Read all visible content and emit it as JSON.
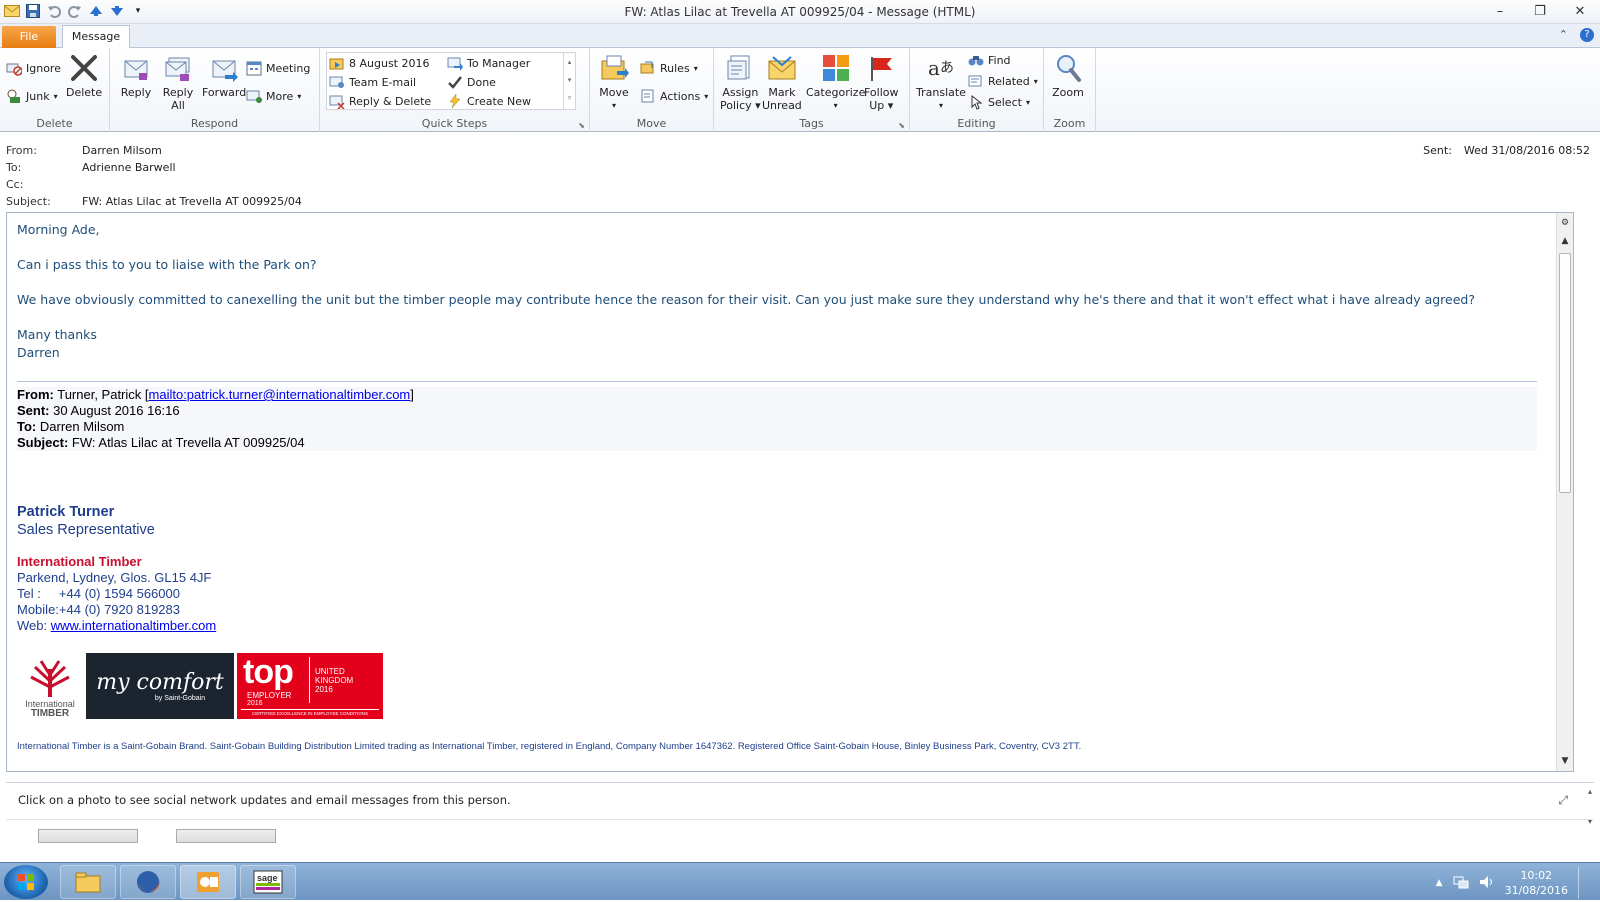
{
  "window": {
    "title": "FW: Atlas Lilac at Trevella AT 009925/04  -  Message (HTML)"
  },
  "tabs": {
    "file": "File",
    "message": "Message"
  },
  "ribbon": {
    "delete_group": {
      "label": "Delete",
      "ignore": "Ignore",
      "junk": "Junk",
      "delete": "Delete"
    },
    "respond_group": {
      "label": "Respond",
      "reply": "Reply",
      "reply_all_1": "Reply",
      "reply_all_2": "All",
      "forward": "Forward",
      "meeting": "Meeting",
      "more": "More"
    },
    "quicksteps_group": {
      "label": "Quick Steps",
      "items": [
        "8 August 2016",
        "To Manager",
        "Team E-mail",
        "Done",
        "Reply & Delete",
        "Create New"
      ]
    },
    "move_group": {
      "label": "Move",
      "move": "Move",
      "rules": "Rules",
      "actions": "Actions"
    },
    "tags_group": {
      "label": "Tags",
      "assign_1": "Assign",
      "assign_2": "Policy",
      "mark_1": "Mark",
      "mark_2": "Unread",
      "categorize": "Categorize",
      "follow_1": "Follow",
      "follow_2": "Up"
    },
    "editing_group": {
      "label": "Editing",
      "translate": "Translate",
      "find": "Find",
      "related": "Related",
      "select": "Select"
    },
    "zoom_group": {
      "label": "Zoom",
      "zoom": "Zoom"
    }
  },
  "header": {
    "from_label": "From:",
    "from": "Darren Milsom",
    "to_label": "To:",
    "to": "Adrienne Barwell",
    "cc_label": "Cc:",
    "cc": "",
    "subject_label": "Subject:",
    "subject": "FW: Atlas Lilac at Trevella AT 009925/04",
    "sent_label": "Sent:",
    "sent": "Wed 31/08/2016 08:52"
  },
  "body": {
    "greeting": "Morning Ade,",
    "line1": "Can i pass this to you to liaise with the Park on?",
    "line2": "We have obviously committed to canexelling the unit but the timber people may contribute hence the reason for their visit. Can you just make sure they understand why he's there and that it won't effect what i have already agreed?",
    "thanks": "Many thanks",
    "signoff": "Darren"
  },
  "forwarded": {
    "from_label": "From:",
    "from_name": "Turner, Patrick [",
    "from_link": "mailto:patrick.turner@internationaltimber.com",
    "from_end": "]",
    "sent_label": "Sent:",
    "sent": "30 August 2016 16:16",
    "to_label": "To:",
    "to": "Darren Milsom",
    "subject_label": "Subject:",
    "subject": "FW: Atlas Lilac at Trevella AT 009925/04"
  },
  "signature": {
    "name": "Patrick Turner",
    "role": "Sales Representative",
    "company": "International Timber",
    "address": "Parkend, Lydney, Glos. GL15 4JF",
    "tel": "Tel :     +44 (0) 1594 566000",
    "mobile": "Mobile:+44 (0) 7920 819283",
    "web_label": "Web: ",
    "web": "www.internationaltimber.com",
    "logo_it_1": "International",
    "logo_it_2": "TIMBER",
    "logo_mc": "my comfort",
    "logo_mc_sub": "by Saint-Gobain",
    "logo_top": "top",
    "logo_top_employer": "EMPLOYER",
    "logo_top_year": "2016",
    "logo_top_uk_1": "UNITED",
    "logo_top_uk_2": "KINGDOM",
    "logo_top_uk_3": "2016",
    "logo_top_cert": "CERTIFIED EXCELLENCE IN EMPLOYEE CONDITIONS",
    "footer": "International Timber is a Saint-Gobain Brand. Saint-Gobain Building Distribution Limited trading as International Timber, registered in England, Company Number 1647362. Registered Office Saint-Gobain House, Binley Business Park, Coventry, CV3 2TT."
  },
  "social": {
    "message": "Click on a photo to see social network updates and email messages from this person."
  },
  "taskbar": {
    "time": "10:02",
    "date": "31/08/2016"
  }
}
